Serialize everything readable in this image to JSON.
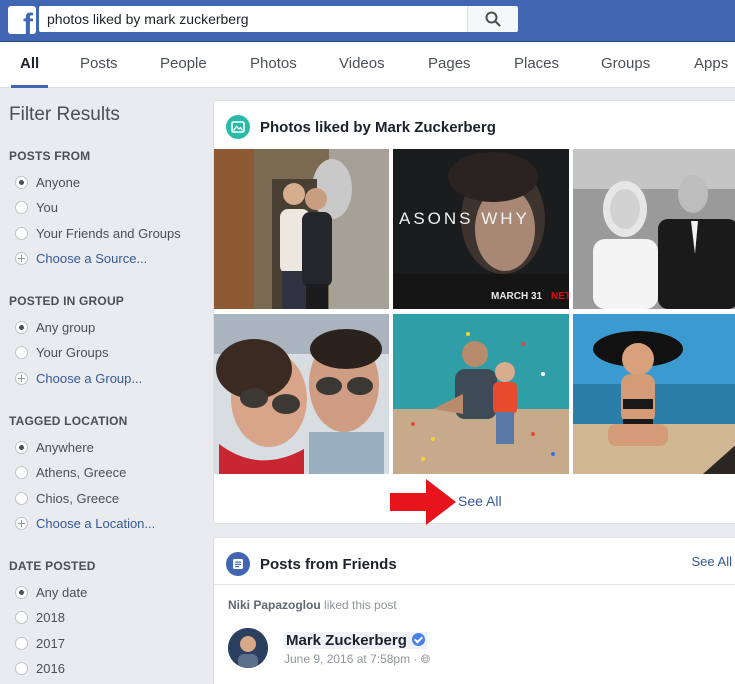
{
  "search": {
    "query": "photos liked by mark zuckerberg"
  },
  "tabs": [
    "All",
    "Posts",
    "People",
    "Photos",
    "Videos",
    "Pages",
    "Places",
    "Groups",
    "Apps"
  ],
  "filters": {
    "title": "Filter Results",
    "sections": [
      {
        "title": "POSTS FROM",
        "options": [
          "Anyone",
          "You",
          "Your Friends and Groups"
        ],
        "selected": 0,
        "add_link": "Choose a Source..."
      },
      {
        "title": "POSTED IN GROUP",
        "options": [
          "Any group",
          "Your Groups"
        ],
        "selected": 0,
        "add_link": "Choose a Group..."
      },
      {
        "title": "TAGGED LOCATION",
        "options": [
          "Anywhere",
          "Athens, Greece",
          "Chios, Greece"
        ],
        "selected": 0,
        "add_link": "Choose a Location..."
      },
      {
        "title": "DATE POSTED",
        "options": [
          "Any date",
          "2018",
          "2017",
          "2016"
        ],
        "selected": 0
      }
    ]
  },
  "photos_card": {
    "title": "Photos liked by Mark Zuckerberg",
    "see_all": "See All",
    "photo_texts": {
      "show_title": "ASONS WHY",
      "show_date": "MARCH 31",
      "show_brand": "NET"
    }
  },
  "posts_card": {
    "title": "Posts from Friends",
    "see_all": "See All",
    "liked_by": "Niki Papazoglou",
    "liked_text": "liked this post",
    "author": "Mark Zuckerberg",
    "date": "June 9, 2016 at 7:58pm",
    "separator": "·"
  },
  "colors": {
    "brand": "#4267b2",
    "link": "#365899",
    "arrow": "#e8141b"
  }
}
